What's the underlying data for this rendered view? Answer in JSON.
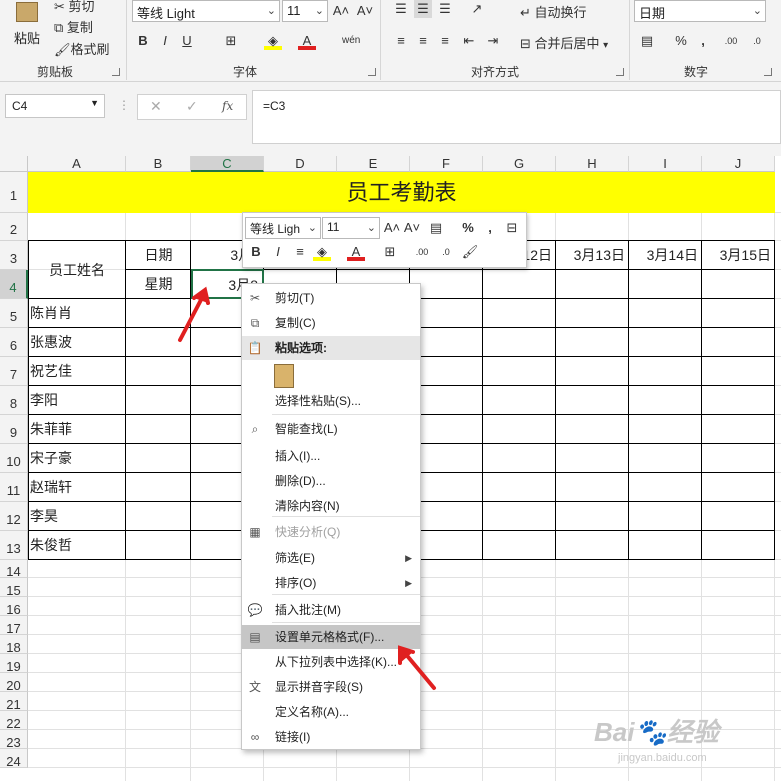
{
  "ribbon": {
    "clipboard": {
      "paste": "粘贴",
      "cut": "剪切",
      "copy": "复制",
      "format_painter": "格式刷",
      "group_label": "剪贴板"
    },
    "font": {
      "family": "等线 Light",
      "size": "11",
      "group_label": "字体",
      "bold": "B",
      "italic": "I",
      "underline": "U"
    },
    "alignment": {
      "wrap_text": "自动换行",
      "merge_center": "合并后居中",
      "group_label": "对齐方式"
    },
    "number": {
      "format": "日期",
      "percent": "%",
      "comma": ",",
      "group_label": "数字"
    }
  },
  "formula_bar": {
    "name_box": "C4",
    "fx": "fx",
    "formula": "=C3"
  },
  "columns": [
    "A",
    "B",
    "C",
    "D",
    "E",
    "F",
    "G",
    "H",
    "I",
    "J"
  ],
  "rows": [
    "1",
    "2",
    "3",
    "4",
    "5",
    "6",
    "7",
    "8",
    "9",
    "10",
    "11",
    "12",
    "13",
    "14",
    "15",
    "16",
    "17",
    "18",
    "19",
    "20",
    "21",
    "22",
    "23",
    "24"
  ],
  "sheet": {
    "title": "员工考勤表",
    "title_fill": "#ffff00",
    "employee_header": "员工姓名",
    "date_label": "日期",
    "weekday_label": "星期",
    "dates_visible": [
      "3月8",
      "3月12日",
      "3月13日",
      "3月14日",
      "3月15日"
    ],
    "c4_value": "3月8",
    "names": [
      "陈肖肖",
      "张惠波",
      "祝艺佳",
      "李阳",
      "朱菲菲",
      "宋子豪",
      "赵瑞轩",
      "李昊",
      "朱俊哲"
    ]
  },
  "mini_toolbar": {
    "font": "等线 Ligh",
    "size": "11",
    "bold": "B",
    "italic": "I",
    "percent": "%",
    "comma": ","
  },
  "context_menu": {
    "items": [
      {
        "label": "剪切(T)",
        "icon": "scissors-icon"
      },
      {
        "label": "复制(C)",
        "icon": "copy-icon"
      },
      {
        "label": "粘贴选项:",
        "icon": "paste-icon"
      },
      {
        "label": "选择性粘贴(S)..."
      },
      {
        "label": "智能查找(L)",
        "icon": "smart-lookup-icon"
      },
      {
        "label": "插入(I)..."
      },
      {
        "label": "删除(D)..."
      },
      {
        "label": "清除内容(N)"
      },
      {
        "label": "快速分析(Q)",
        "icon": "quick-analysis-icon"
      },
      {
        "label": "筛选(E)"
      },
      {
        "label": "排序(O)"
      },
      {
        "label": "插入批注(M)",
        "icon": "comment-icon"
      },
      {
        "label": "设置单元格格式(F)...",
        "icon": "format-cells-icon"
      },
      {
        "label": "从下拉列表中选择(K)..."
      },
      {
        "label": "显示拼音字段(S)",
        "icon": "pinyin-icon"
      },
      {
        "label": "定义名称(A)..."
      },
      {
        "label": "链接(I)",
        "icon": "link-icon"
      }
    ]
  },
  "watermark": {
    "text": "Bai",
    "text2": "经验",
    "url": "jingyan.baidu.com"
  },
  "colors": {
    "accent_red": "#e02020",
    "selected_green": "#217346"
  }
}
